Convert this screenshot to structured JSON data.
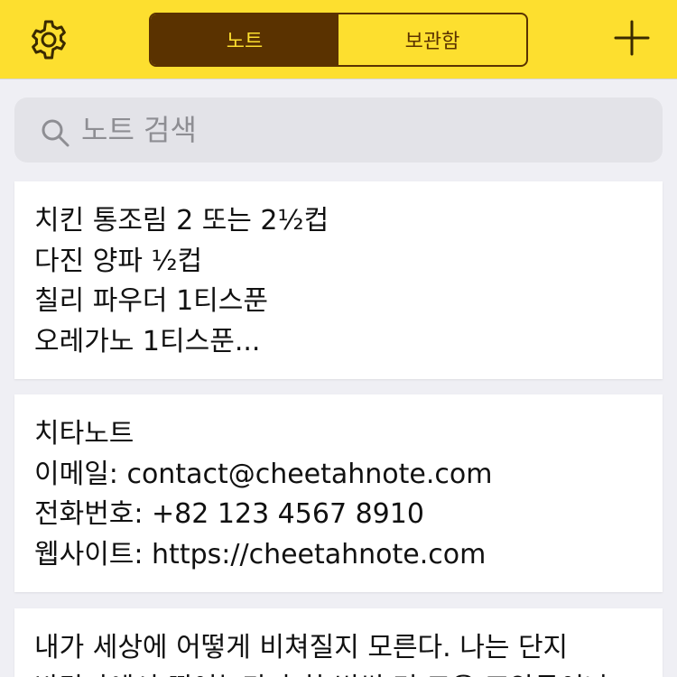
{
  "header": {
    "settings_icon": "gear-icon",
    "tabs": [
      {
        "label": "노트",
        "active": true
      },
      {
        "label": "보관함",
        "active": false
      }
    ],
    "add_icon": "plus-icon",
    "accent_color": "#fddf2f",
    "brand_dark": "#5a3200"
  },
  "search": {
    "placeholder": "노트 검색",
    "value": "",
    "icon": "search-icon"
  },
  "notes": [
    {
      "lines": [
        "치킨 통조림 2 또는 2½컵",
        "다진 양파 ½컵",
        "칠리 파우더 1티스푼",
        "오레가노 1티스푼..."
      ]
    },
    {
      "lines": [
        "치타노트",
        "이메일: contact@cheetahnote.com",
        "전화번호: +82 123 4567 8910",
        "웹사이트: https://cheetahnote.com"
      ]
    },
    {
      "lines": [
        "내가 세상에 어떻게 비쳐질지 모른다. 나는 단지",
        "바닷가에서 뛰어놀다가 한 번씩 더 고운 조약돌이나"
      ]
    }
  ]
}
